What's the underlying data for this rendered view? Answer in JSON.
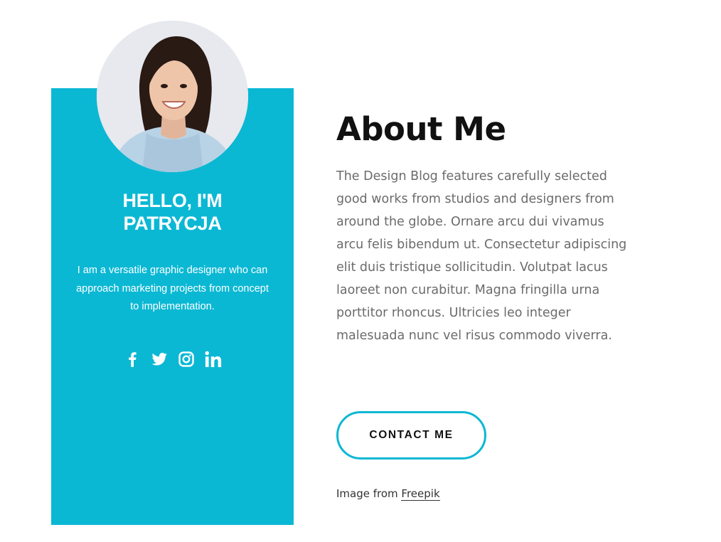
{
  "profile": {
    "greeting_line1": "HELLO, I'M",
    "greeting_line2": "PATRYCJA",
    "description": "I am a versatile graphic designer who can approach marketing projects from concept to implementation.",
    "accent_color": "#0bb8d4"
  },
  "socials": [
    {
      "icon": "facebook-icon"
    },
    {
      "icon": "twitter-icon"
    },
    {
      "icon": "instagram-icon"
    },
    {
      "icon": "linkedin-icon"
    }
  ],
  "about": {
    "title": "About Me",
    "body": "The Design Blog features carefully selected good works from studios and designers from around the globe. Ornare arcu dui vivamus arcu felis bibendum ut. Consectetur adipiscing elit duis tristique sollicitudin. Volutpat lacus laoreet non curabitur. Magna fringilla urna porttitor rhoncus. Ultricies leo integer malesuada nunc vel risus commodo viverra.",
    "cta_label": "CONTACT ME",
    "credit_prefix": "Image from ",
    "credit_link": "Freepik"
  }
}
